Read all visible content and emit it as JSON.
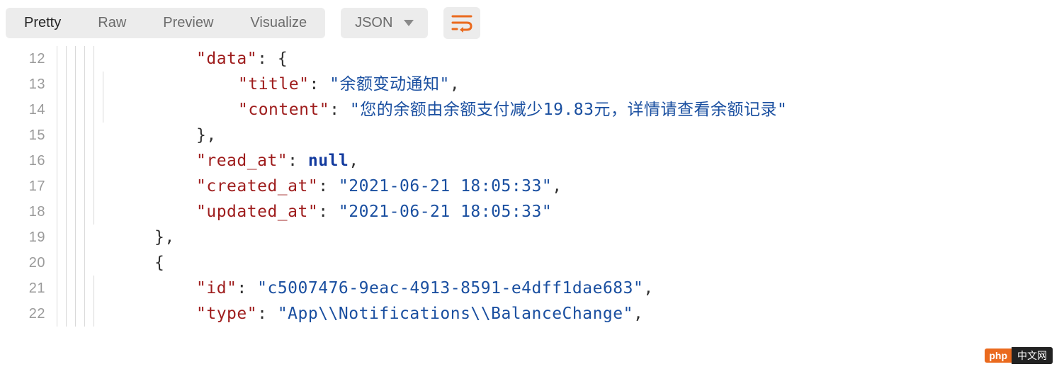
{
  "toolbar": {
    "tabs": {
      "pretty": "Pretty",
      "raw": "Raw",
      "preview": "Preview",
      "visualize": "Visualize"
    },
    "format": "JSON"
  },
  "lines": {
    "r12": {
      "no": "12",
      "key": "data",
      "after_key": ": ",
      "brace": "{"
    },
    "r13": {
      "no": "13",
      "key": "title",
      "after_key": ": ",
      "val": "余额变动通知",
      "trail": ","
    },
    "r14": {
      "no": "14",
      "key": "content",
      "after_key": ": ",
      "val": "您的余额由余额支付减少19.83元，详情请查看余额记录",
      "trail": ""
    },
    "r15": {
      "no": "15",
      "brace": "},",
      "indent": 4
    },
    "r16": {
      "no": "16",
      "key": "read_at",
      "after_key": ": ",
      "nullval": "null",
      "trail": ","
    },
    "r17": {
      "no": "17",
      "key": "created_at",
      "after_key": ": ",
      "val": "2021-06-21 18:05:33",
      "trail": ","
    },
    "r18": {
      "no": "18",
      "key": "updated_at",
      "after_key": ": ",
      "val": "2021-06-21 18:05:33",
      "trail": ""
    },
    "r19": {
      "no": "19",
      "brace": "},",
      "indent": 3
    },
    "r20": {
      "no": "20",
      "brace": "{",
      "indent": 3
    },
    "r21": {
      "no": "21",
      "key": "id",
      "after_key": ": ",
      "val": "c5007476-9eac-4913-8591-e4dff1dae683",
      "trail": ","
    },
    "r22": {
      "no": "22",
      "key": "type",
      "after_key": ": ",
      "val": "App\\\\Notifications\\\\BalanceChange",
      "trail": ","
    }
  },
  "badge": {
    "left": "php",
    "right": "中文网"
  }
}
